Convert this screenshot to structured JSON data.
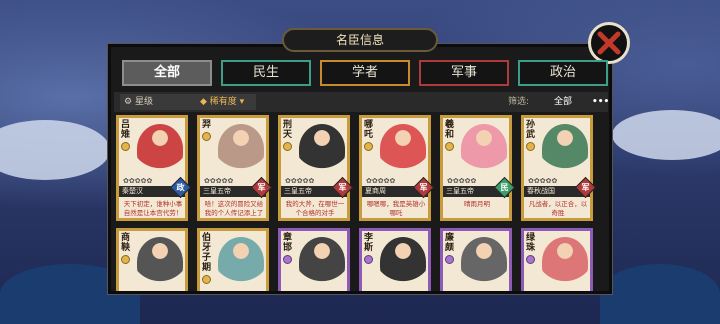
{
  "panel": {
    "title": "名臣信息"
  },
  "tabs": [
    {
      "label": "全部",
      "active": true
    },
    {
      "label": "民生"
    },
    {
      "label": "学者"
    },
    {
      "label": "军事"
    },
    {
      "label": "政治"
    }
  ],
  "filter": {
    "star_label": "星级",
    "rarity_label": "稀有度",
    "screen_label": "筛选:",
    "all_label": "全部",
    "more_label": "•••"
  },
  "type_colors": {
    "政": "#2c5aa6",
    "军": "#b03a3a",
    "民": "#3e9d6a"
  },
  "cards": [
    {
      "name": "吕雉",
      "origin": "秦楚汉",
      "type": "政",
      "quote": "天下初定，谁种小事自然是让本宫代劳！",
      "color": "#c44"
    },
    {
      "name": "羿",
      "origin": "三皇五帝",
      "type": "军",
      "quote": "哈！这次的冒险又给我的个人传记添上了",
      "color": "#b98"
    },
    {
      "name": "刑天",
      "origin": "三皇五帝",
      "type": "军",
      "quote": "我的大斧，在哪世一个合格的对手",
      "color": "#333"
    },
    {
      "name": "哪吒",
      "origin": "夏商周",
      "type": "军",
      "quote": "哪嗯哪，我是英雄小哪吒",
      "color": "#d55"
    },
    {
      "name": "羲和",
      "origin": "三皇五帝",
      "type": "民",
      "quote": "晴雨月明",
      "color": "#e9a"
    },
    {
      "name": "孙武",
      "origin": "春秋战国",
      "type": "军",
      "quote": "凡战者，以正合，以奇胜",
      "color": "#586"
    },
    {
      "name": "商鞅",
      "rank": "gold",
      "color": "#555"
    },
    {
      "name": "伯牙子期",
      "rank": "gold",
      "color": "#7aa"
    },
    {
      "name": "章邯",
      "rank": "purple",
      "color": "#444"
    },
    {
      "name": "李斯",
      "rank": "purple",
      "color": "#333"
    },
    {
      "name": "廉颇",
      "rank": "purple",
      "color": "#666"
    },
    {
      "name": "绿珠",
      "rank": "purple",
      "color": "#d77"
    }
  ]
}
